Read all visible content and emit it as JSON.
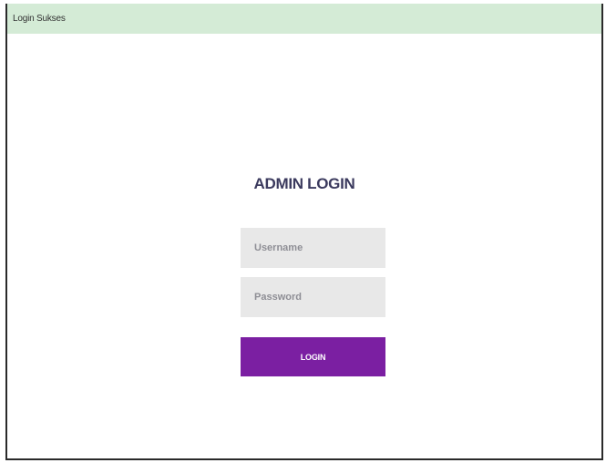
{
  "alert": {
    "message": "Login Sukses"
  },
  "login_form": {
    "title": "ADMIN LOGIN",
    "username_placeholder": "Username",
    "username_value": "",
    "password_placeholder": "Password",
    "password_value": "",
    "submit_label": "LOGIN"
  },
  "colors": {
    "alert_background": "#d4ebd6",
    "title": "#3b3a5e",
    "input_background": "#e8e8e8",
    "button_background": "#7b1fa2",
    "button_text": "#ffffff"
  }
}
